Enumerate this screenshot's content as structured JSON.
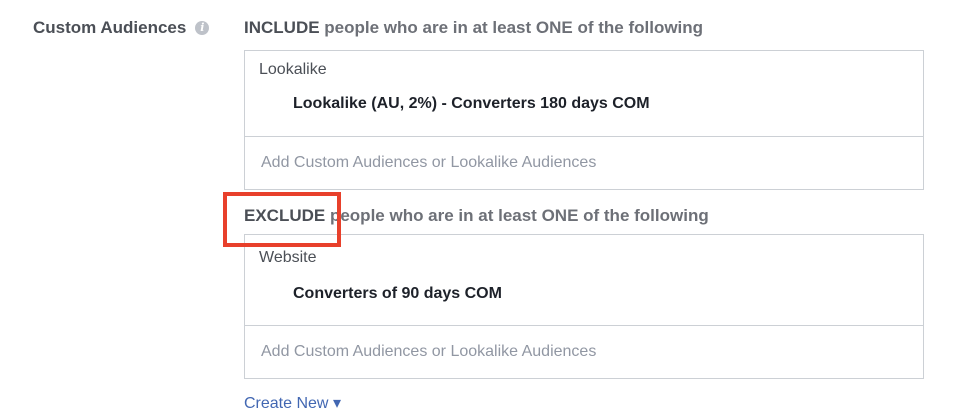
{
  "section": {
    "label": "Custom Audiences",
    "info_icon": "info-icon"
  },
  "include": {
    "keyword": "INCLUDE",
    "text": " people who are in at least ONE of the following",
    "category": "Lookalike",
    "audience": "Lookalike (AU, 2%) - Converters 180 days COM",
    "placeholder": "Add Custom Audiences or Lookalike Audiences"
  },
  "exclude": {
    "keyword": "EXCLUDE",
    "text": " people who are in at least ONE of the following",
    "category": "Website",
    "audience": "Converters of 90 days COM",
    "placeholder": "Add Custom Audiences or Lookalike Audiences"
  },
  "create_link": "Create New",
  "colors": {
    "highlight": "#e8402b",
    "link": "#4267b2"
  }
}
